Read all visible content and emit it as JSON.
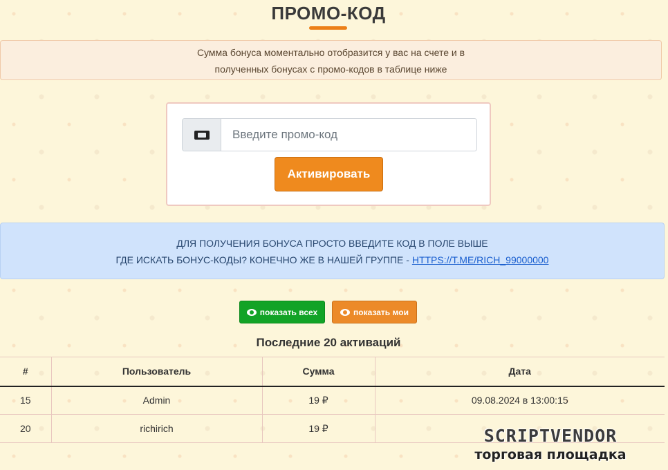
{
  "header": {
    "title": "ПРОМО-КОД"
  },
  "info": {
    "line1": "Сумма бонуса моментально отобразится у вас на счете и в",
    "line2": "полученных бонусах с промо-кодов в таблице ниже"
  },
  "promo": {
    "icon": "ticket-icon",
    "input_value": "",
    "input_placeholder": "Введите промо-код",
    "activate_label": "Активировать"
  },
  "notice": {
    "line1": "Для получения бонуса просто введите код в поле выше",
    "line2_prefix": "Где искать бонус-коды? Конечно же в нашей группе - ",
    "link_text": "https://t.me/rich_99000000"
  },
  "filters": {
    "show_all": "показать всех",
    "show_mine": "показать мои",
    "icon": "eye-icon",
    "colors": {
      "all": "#12a326",
      "mine": "#ec8a29"
    }
  },
  "table": {
    "title": "Последние 20 активаций",
    "columns": [
      "#",
      "Пользователь",
      "Сумма",
      "Дата"
    ],
    "rows": [
      {
        "id": "15",
        "user": "Admin",
        "amount": "19 ₽",
        "date": "09.08.2024 в 13:00:15"
      },
      {
        "id": "20",
        "user": "richirich",
        "amount": "19 ₽",
        "date": ""
      }
    ]
  },
  "watermark": {
    "logo": "SCRIPTVENDOR",
    "subtitle": "торговая площадка"
  },
  "colors": {
    "accent": "#ec7f17",
    "background": "#fdf6da",
    "notice_bg": "#d0e3fc"
  }
}
